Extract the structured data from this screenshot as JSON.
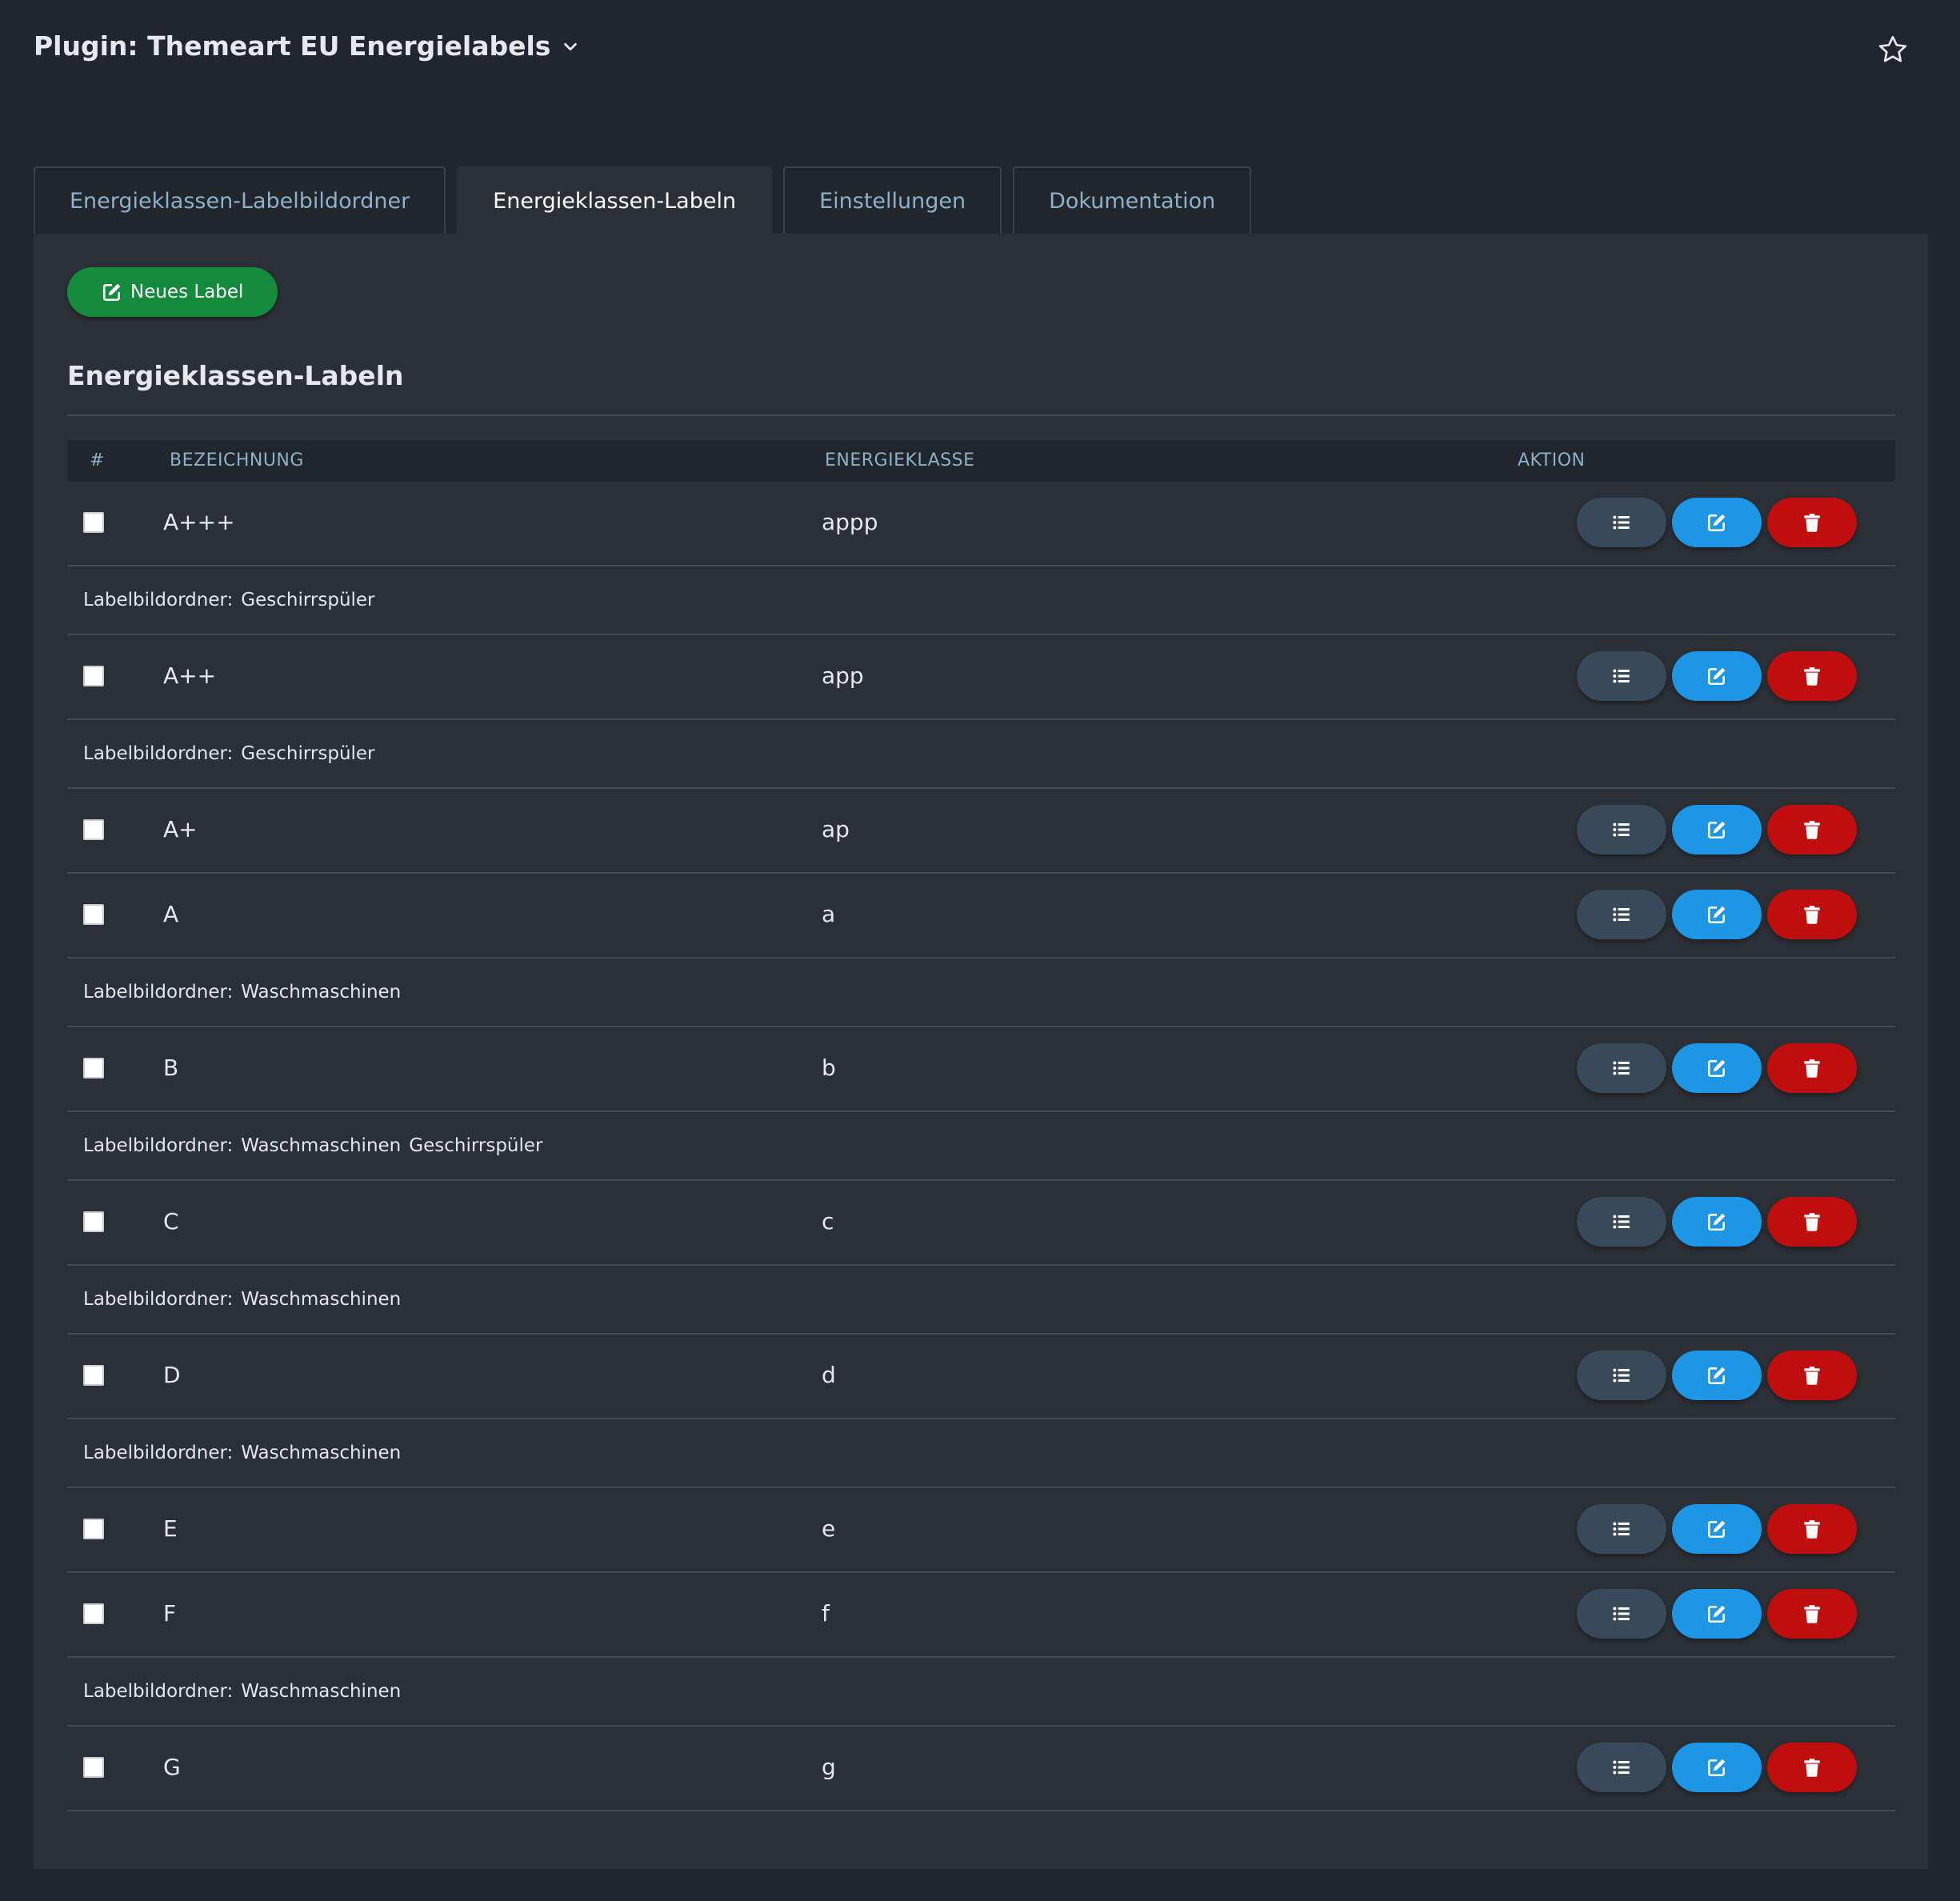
{
  "header": {
    "title": "Plugin: Themeart EU Energielabels"
  },
  "tabs": [
    {
      "label": "Energieklassen-Labelbildordner",
      "active": false
    },
    {
      "label": "Energieklassen-Labeln",
      "active": true
    },
    {
      "label": "Einstellungen",
      "active": false
    },
    {
      "label": "Dokumentation",
      "active": false
    }
  ],
  "toolbar": {
    "new_label": "Neues Label"
  },
  "section": {
    "title": "Energieklassen-Labeln"
  },
  "table": {
    "headers": {
      "num": "#",
      "name": "Bezeichnung",
      "class": "Energieklasse",
      "action": "Aktion"
    },
    "info_prefix": "Labelbildordner:",
    "rows": [
      {
        "name": "A+++",
        "class": "appp",
        "folders": [
          "Geschirrspüler"
        ]
      },
      {
        "name": "A++",
        "class": "app",
        "folders": [
          "Geschirrspüler"
        ]
      },
      {
        "name": "A+",
        "class": "ap",
        "folders": []
      },
      {
        "name": "A",
        "class": "a",
        "folders": [
          "Waschmaschinen"
        ]
      },
      {
        "name": "B",
        "class": "b",
        "folders": [
          "Waschmaschinen",
          "Geschirrspüler"
        ]
      },
      {
        "name": "C",
        "class": "c",
        "folders": [
          "Waschmaschinen"
        ]
      },
      {
        "name": "D",
        "class": "d",
        "folders": [
          "Waschmaschinen"
        ]
      },
      {
        "name": "E",
        "class": "e",
        "folders": []
      },
      {
        "name": "F",
        "class": "f",
        "folders": [
          "Waschmaschinen"
        ]
      },
      {
        "name": "G",
        "class": "g",
        "folders": []
      }
    ]
  },
  "colors": {
    "background": "#21252c",
    "panel": "#2b3036",
    "new_button": "#148a3d",
    "list_button": "#38495a",
    "edit_button": "#1e96e6",
    "delete_button": "#c00d0d",
    "accent_text": "#8fb0c9"
  },
  "icons": {
    "title_dropdown": "chevron-down-icon",
    "favorite": "star-icon",
    "new_label": "edit-icon",
    "row_list": "list-icon",
    "row_edit": "edit-icon",
    "row_delete": "trash-icon"
  }
}
